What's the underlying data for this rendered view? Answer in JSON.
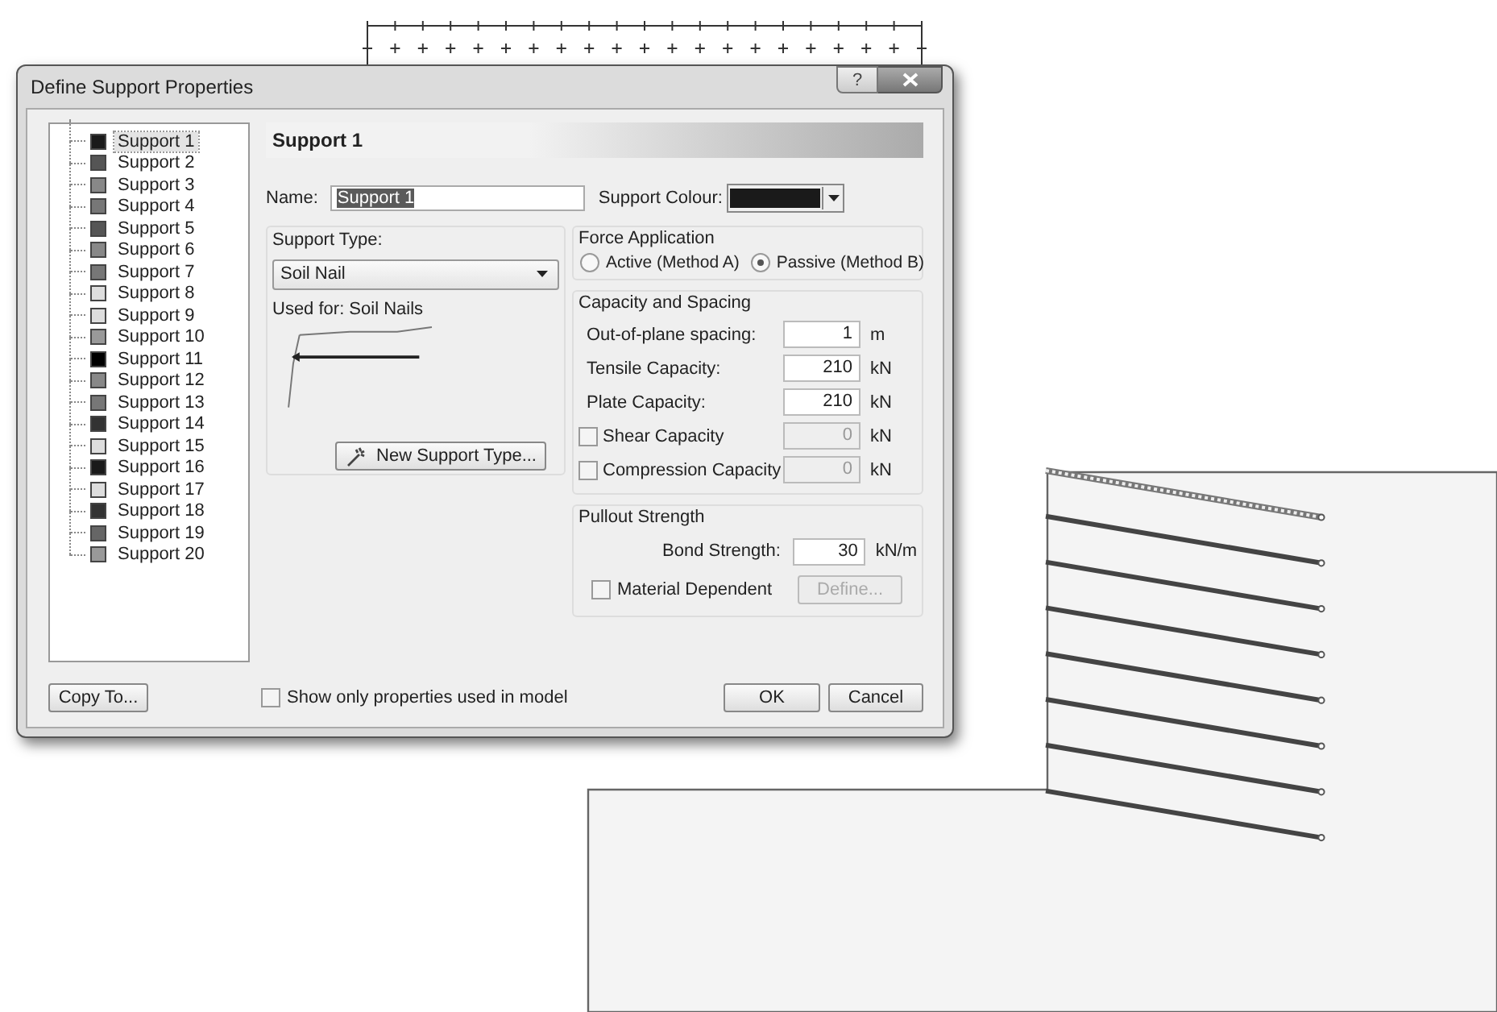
{
  "window": {
    "title": "Define Support Properties",
    "help": "?"
  },
  "supports": [
    {
      "label": "Support 1",
      "color": "#1a1a1a",
      "selected": true
    },
    {
      "label": "Support 2",
      "color": "#555555",
      "selected": false
    },
    {
      "label": "Support 3",
      "color": "#888888",
      "selected": false
    },
    {
      "label": "Support 4",
      "color": "#777777",
      "selected": false
    },
    {
      "label": "Support 5",
      "color": "#555555",
      "selected": false
    },
    {
      "label": "Support 6",
      "color": "#888888",
      "selected": false
    },
    {
      "label": "Support 7",
      "color": "#777777",
      "selected": false
    },
    {
      "label": "Support 8",
      "color": "#dddddd",
      "selected": false
    },
    {
      "label": "Support 9",
      "color": "#dddddd",
      "selected": false
    },
    {
      "label": "Support 10",
      "color": "#999999",
      "selected": false
    },
    {
      "label": "Support 11",
      "color": "#000000",
      "selected": false
    },
    {
      "label": "Support 12",
      "color": "#888888",
      "selected": false
    },
    {
      "label": "Support 13",
      "color": "#777777",
      "selected": false
    },
    {
      "label": "Support 14",
      "color": "#333333",
      "selected": false
    },
    {
      "label": "Support 15",
      "color": "#dddddd",
      "selected": false
    },
    {
      "label": "Support 16",
      "color": "#1a1a1a",
      "selected": false
    },
    {
      "label": "Support 17",
      "color": "#dddddd",
      "selected": false
    },
    {
      "label": "Support 18",
      "color": "#333333",
      "selected": false
    },
    {
      "label": "Support 19",
      "color": "#666666",
      "selected": false
    },
    {
      "label": "Support 20",
      "color": "#999999",
      "selected": false
    }
  ],
  "header": "Support 1",
  "name": {
    "label": "Name:",
    "value": "Support 1",
    "highlighted": true
  },
  "support_colour": {
    "label": "Support Colour:",
    "color": "#1a1a1a"
  },
  "support_type": {
    "label": "Support Type:",
    "value": "Soil Nail",
    "used_for": "Used for: Soil Nails",
    "button": "New Support Type..."
  },
  "force_application": {
    "title": "Force Application",
    "options": [
      {
        "label": "Active (Method A)",
        "selected": false
      },
      {
        "label": "Passive (Method B)",
        "selected": true
      }
    ]
  },
  "capacity": {
    "title": "Capacity and Spacing",
    "rows": [
      {
        "kind": "field",
        "label": "Out-of-plane spacing:",
        "value": "1",
        "unit": "m"
      },
      {
        "kind": "field",
        "label": "Tensile Capacity:",
        "value": "210",
        "unit": "kN"
      },
      {
        "kind": "field",
        "label": "Plate Capacity:",
        "value": "210",
        "unit": "kN"
      },
      {
        "kind": "check",
        "label": "Shear Capacity",
        "checked": false,
        "value": "0",
        "unit": "kN"
      },
      {
        "kind": "check",
        "label": "Compression Capacity",
        "checked": false,
        "value": "0",
        "unit": "kN"
      }
    ]
  },
  "pullout": {
    "title": "Pullout Strength",
    "bond_label": "Bond Strength:",
    "bond_value": "30",
    "bond_unit": "kN/m",
    "material": {
      "label": "Material Dependent",
      "checked": false
    },
    "define_button": "Define..."
  },
  "footer": {
    "copy_button": "Copy To...",
    "show_only": {
      "label": "Show only properties used in model",
      "checked": false
    },
    "buttons": [
      "OK",
      "Cancel"
    ]
  },
  "model": {
    "nails": [
      {
        "selected": true
      },
      {
        "selected": false
      },
      {
        "selected": false
      },
      {
        "selected": false
      },
      {
        "selected": false
      },
      {
        "selected": false
      },
      {
        "selected": false
      },
      {
        "selected": false
      }
    ]
  }
}
